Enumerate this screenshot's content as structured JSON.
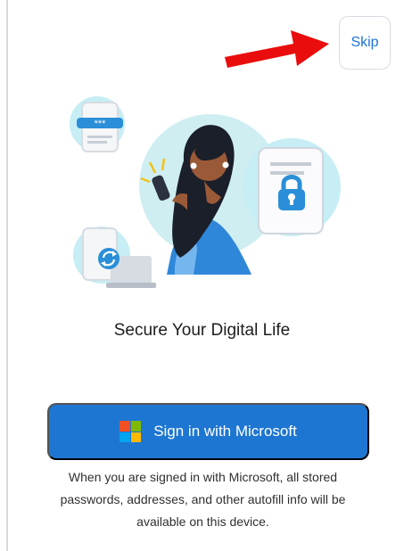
{
  "skip": {
    "label": "Skip"
  },
  "main": {
    "title": "Secure Your Digital Life",
    "sign_in_button_label": "Sign in with Microsoft",
    "footnote": "When you are signed in with Microsoft, all stored passwords, addresses, and other autofill info will be available on this device."
  },
  "illustration": {
    "password_mask": "***"
  },
  "colors": {
    "accent": "#1d76d2",
    "skip_text": "#1d73d8",
    "arrow": "#ea0d0d",
    "hero_bubble": "#cfeef2",
    "hero_accent": "#2a8fd8",
    "microsoft_red": "#f25022",
    "microsoft_green": "#7fba00",
    "microsoft_blue": "#00a4ef",
    "microsoft_yellow": "#ffb900"
  },
  "icons": {
    "skip_arrow": "red-arrow-icon",
    "microsoft_logo": "microsoft-logo-icon",
    "lock": "lock-icon",
    "sync": "sync-icon"
  }
}
